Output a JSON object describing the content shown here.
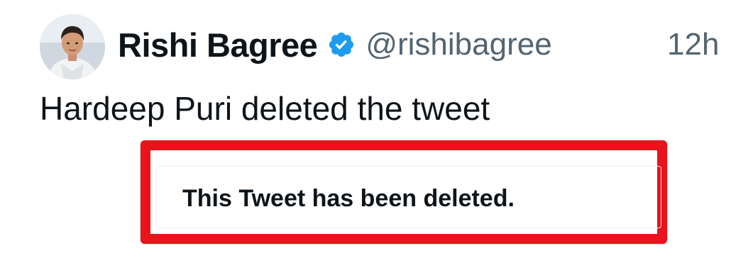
{
  "tweet": {
    "display_name": "Rishi Bagree",
    "handle": "@rishibagree",
    "timestamp": "12h",
    "text": "Hardeep Puri deleted the tweet",
    "verified_badge_icon": "verified-check-icon",
    "badge_color": "#1d9bf0"
  },
  "quoted": {
    "deleted_message": "This Tweet has been deleted.",
    "highlight_color": "#e8131b"
  }
}
